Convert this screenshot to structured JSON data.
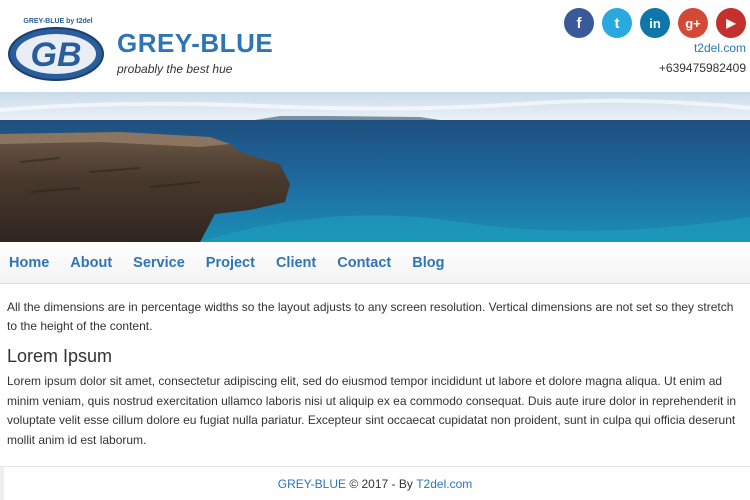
{
  "header": {
    "logo_text": "GREY-BLUE by t2del",
    "title": "GREY-BLUE",
    "tagline": "probably the best hue",
    "website": "t2del.com",
    "phone": "+639475982409"
  },
  "social": [
    {
      "icon": "facebook-icon",
      "glyph": "f",
      "color": "#3b5998"
    },
    {
      "icon": "twitter-icon",
      "glyph": "t",
      "color": "#2aa9e0"
    },
    {
      "icon": "linkedin-icon",
      "glyph": "in",
      "color": "#0e76a8"
    },
    {
      "icon": "google-plus-icon",
      "glyph": "g+",
      "color": "#d34836"
    },
    {
      "icon": "youtube-icon",
      "glyph": "▶",
      "color": "#c4302b"
    }
  ],
  "nav": {
    "items": [
      "Home",
      "About",
      "Service",
      "Project",
      "Client",
      "Contact",
      "Blog"
    ]
  },
  "main": {
    "intro": "All the dimensions are in percentage widths so the layout adjusts to any screen resolution. Vertical dimensions are not set so they stretch to the height of the content.",
    "heading": "Lorem Ipsum",
    "body": "Lorem ipsum dolor sit amet, consectetur adipiscing elit, sed do eiusmod tempor incididunt ut labore et dolore magna aliqua. Ut enim ad minim veniam, quis nostrud exercitation ullamco laboris nisi ut aliquip ex ea commodo consequat. Duis aute irure dolor in reprehenderit in voluptate velit esse cillum dolore eu fugiat nulla pariatur. Excepteur sint occaecat cupidatat non proident, sunt in culpa qui officia deserunt mollit anim id est laborum."
  },
  "footer": {
    "brand": "GREY-BLUE",
    "copyright": " © 2017 - By ",
    "author": "T2del.com"
  },
  "colors": {
    "accent": "#2e75b6",
    "text": "#333333"
  }
}
